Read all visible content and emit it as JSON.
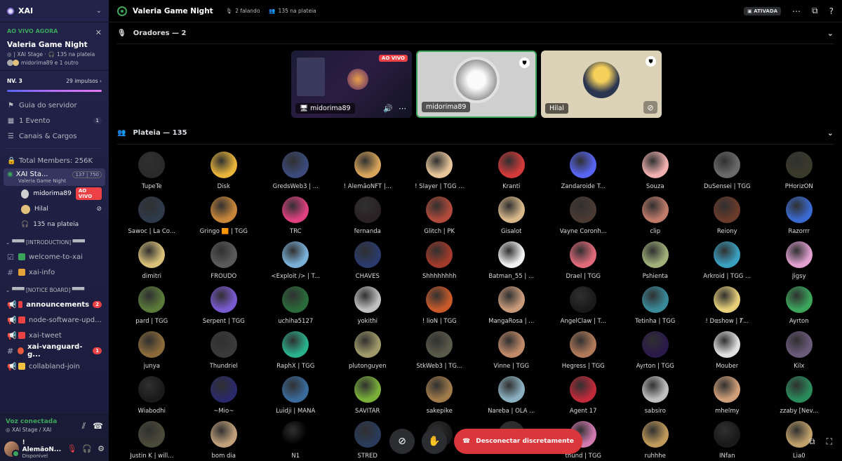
{
  "server": {
    "name": "XAI"
  },
  "live_card": {
    "tag": "AO VIVO AGORA",
    "title": "Valeria Game Night",
    "stage_line": "| XAI Stage ·",
    "audience_line": "135 na plateia",
    "speakers_line": "midorima89 e 1 outro"
  },
  "boost": {
    "level": "NV. 3",
    "count": "29 impulsos",
    "progress": 1.0
  },
  "nav": [
    {
      "icon": "signpost-icon",
      "label": "Guia do servidor",
      "count": ""
    },
    {
      "icon": "calendar-icon",
      "label": "1 Evento",
      "count": "1"
    },
    {
      "icon": "list-icon",
      "label": "Canais & Cargos",
      "count": ""
    }
  ],
  "total_members": "Total Members: 256K",
  "stage_channel": {
    "name": "XAI Sta...",
    "count": "137",
    "limit": "750",
    "sub": "Valeria Game Night"
  },
  "stage_speakers": [
    {
      "name": "midorima89",
      "live": "AO VIVO"
    },
    {
      "name": "Hilal",
      "live": ""
    }
  ],
  "stage_audience": "135 na plateia",
  "categories": [
    {
      "label": "▀▀▀ [INTRODUCTION] ▀▀▀",
      "channels": [
        {
          "name": "welcome-to-xai",
          "emoji": "#3ba55c",
          "unread": false,
          "badge": ""
        },
        {
          "name": "xai-info",
          "emoji": "#e8a23a",
          "unread": false,
          "badge": ""
        }
      ]
    },
    {
      "label": "▀▀▀ [NOTICE BOARD] ▀▀▀",
      "channels": [
        {
          "name": "announcements",
          "emoji": "#ed4245",
          "unread": true,
          "badge": "2"
        },
        {
          "name": "node-software-upd...",
          "emoji": "#ed4245",
          "unread": false,
          "badge": ""
        },
        {
          "name": "xai-tweet",
          "emoji": "#ed4245",
          "unread": false,
          "badge": ""
        },
        {
          "name": "xai-vanguard-g...",
          "emoji": "#e85a3a",
          "unread": true,
          "badge": "1"
        },
        {
          "name": "collabland-join",
          "emoji": "#f0c040",
          "unread": false,
          "badge": ""
        }
      ]
    }
  ],
  "voice": {
    "status": "Voz conectada",
    "location": "XAI Stage / XAI"
  },
  "user": {
    "name": "! AlemãoN...",
    "status": "Disponível"
  },
  "topbar": {
    "title": "Valeria Game Night",
    "speaking": "2 falando",
    "audience": "135 na plateia",
    "active": "ATIVADA"
  },
  "speakers_section": {
    "label": "Oradores — 2"
  },
  "speakers": [
    {
      "name": "midorima89",
      "type": "screen",
      "live": "AO VIVO"
    },
    {
      "name": "midorima89",
      "type": "avatar",
      "live": ""
    },
    {
      "name": "Hilal",
      "type": "avatar",
      "live": ""
    }
  ],
  "audience_section": {
    "label": "Plateia — 135"
  },
  "audience": [
    {
      "name": "TupeTe",
      "color": "#2a2a2a"
    },
    {
      "name": "Disk",
      "color": "#e8b43a"
    },
    {
      "name": "GredsWeb3 | ...",
      "color": "#3b4a7a"
    },
    {
      "name": "! AlemãoNFT |...",
      "color": "#d6a45a"
    },
    {
      "name": "! Slayer | TGG ...",
      "color": "#e7c59a"
    },
    {
      "name": "Kranti",
      "color": "#d23a3a"
    },
    {
      "name": "Zandaroide T...",
      "color": "#5865f2"
    },
    {
      "name": "Souza",
      "color": "#f0b0b0"
    },
    {
      "name": "DuSensei | TGG",
      "color": "#6a6a6a"
    },
    {
      "name": "PHorizON",
      "color": "#3a3a2a"
    },
    {
      "name": "Sawoc | La Co...",
      "color": "#2e3a4a"
    },
    {
      "name": "Gringo 🟧 | TGG",
      "color": "#c8863a"
    },
    {
      "name": "TRC",
      "color": "#e04080"
    },
    {
      "name": "fernanda",
      "color": "#2a2226"
    },
    {
      "name": "Glitch | PK",
      "color": "#b04a3a"
    },
    {
      "name": "Gisalot",
      "color": "#d8b88a"
    },
    {
      "name": "Vayne Coronh...",
      "color": "#4a3a32"
    },
    {
      "name": "clip",
      "color": "#c07a6a"
    },
    {
      "name": "Reiony",
      "color": "#6a3a2a"
    },
    {
      "name": "Razorrr",
      "color": "#3a6ad0"
    },
    {
      "name": "dimitri",
      "color": "#d8c07a"
    },
    {
      "name": "FROUDO",
      "color": "#5a5a5a"
    },
    {
      "name": "<Exploit /> | T...",
      "color": "#7ab0d8"
    },
    {
      "name": "CHAVES",
      "color": "#2a3a6a"
    },
    {
      "name": "Shhhhhhhh",
      "color": "#a03a2a"
    },
    {
      "name": "Batman_55 | ...",
      "color": "#f0f0f0"
    },
    {
      "name": "Drael | TGG",
      "color": "#e06a7a"
    },
    {
      "name": "Pshienta",
      "color": "#a0b07a"
    },
    {
      "name": "Arkroid | TGG ...",
      "color": "#3aa0c0"
    },
    {
      "name": "Jigsy",
      "color": "#e0a0d0"
    },
    {
      "name": "pard | TGG",
      "color": "#5a7a3a"
    },
    {
      "name": "Serpent | TGG",
      "color": "#7a5ad0"
    },
    {
      "name": "uchiha5127",
      "color": "#2a6a3a"
    },
    {
      "name": "yokithi",
      "color": "#c0c0c0"
    },
    {
      "name": "! lioN | TGG",
      "color": "#c85a2a"
    },
    {
      "name": "MangaRosa | ...",
      "color": "#c89a7a"
    },
    {
      "name": "AngelClaw | T...",
      "color": "#1a1a1a"
    },
    {
      "name": "Tetinha | TGG",
      "color": "#3a8a9a"
    },
    {
      "name": "! Dαshow | 𝑻...",
      "color": "#e8d07a"
    },
    {
      "name": "Ayrton",
      "color": "#3ba55c"
    },
    {
      "name": "junya",
      "color": "#8a6a3a"
    },
    {
      "name": "Thundriel",
      "color": "#3a3a3a"
    },
    {
      "name": "RaphX | TGG",
      "color": "#2ab08a"
    },
    {
      "name": "plutonguyen",
      "color": "#a09a6a"
    },
    {
      "name": "StkWeb3 | TG...",
      "color": "#5a5a4a"
    },
    {
      "name": "Vinne | TGG",
      "color": "#c08a6a"
    },
    {
      "name": "Hegress | TGG",
      "color": "#b07a5a"
    },
    {
      "name": "Ayrton | TGG",
      "color": "#2a1a4a"
    },
    {
      "name": "Mouber",
      "color": "#e0e0e0"
    },
    {
      "name": "Kilx",
      "color": "#6a5a7a"
    },
    {
      "name": "Wiabodhi",
      "color": "#1a1a1a"
    },
    {
      "name": "~Mio~",
      "color": "#2a2a6a"
    },
    {
      "name": "Luidji | MANA",
      "color": "#3a6a9a"
    },
    {
      "name": "SAVITAR",
      "color": "#7ab03a"
    },
    {
      "name": "sakepike",
      "color": "#a07a4a"
    },
    {
      "name": "Nareba | OLA ...",
      "color": "#8ab0c0"
    },
    {
      "name": "Agent 17",
      "color": "#c02a3a"
    },
    {
      "name": "sabsiro",
      "color": "#c0c0c0"
    },
    {
      "name": "mhelmy",
      "color": "#d0a07a"
    },
    {
      "name": "zzaby [Nev...",
      "color": "#2a8a5a"
    },
    {
      "name": "Justin K | will...",
      "color": "#4a4a3a"
    },
    {
      "name": "bom dia",
      "color": "#c0a07a"
    },
    {
      "name": "N1",
      "color": "#000000"
    },
    {
      "name": "STRED",
      "color": "#2a3a5a"
    },
    {
      "name": "",
      "color": "#1a1a1a"
    },
    {
      "name": "",
      "color": "#2a2a2a"
    },
    {
      "name": "thund | TGG",
      "color": "#d07ab0"
    },
    {
      "name": "ruhhhe",
      "color": "#c09a5a"
    },
    {
      "name": "INfan",
      "color": "#1a1a1a"
    },
    {
      "name": "Lia0",
      "color": "#c0a06a"
    }
  ],
  "bottom": {
    "disconnect": "Desconectar discretamente"
  }
}
